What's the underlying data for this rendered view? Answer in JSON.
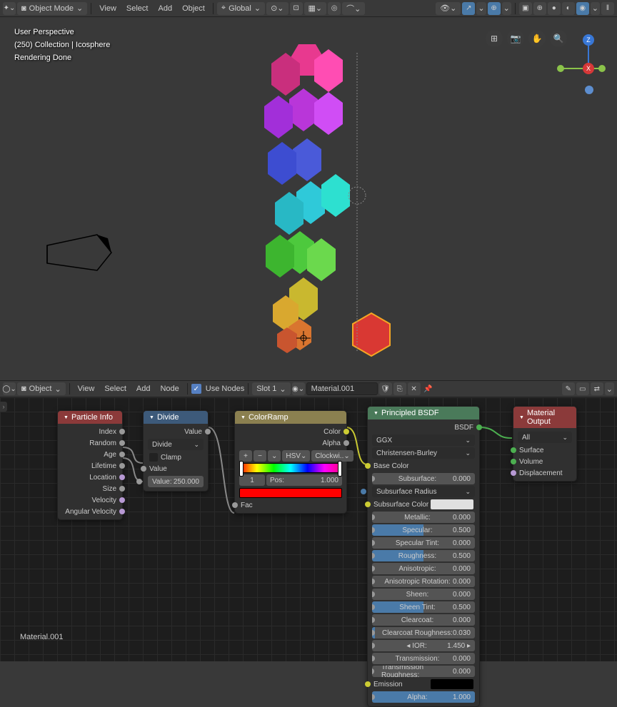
{
  "header": {
    "mode": "Object Mode",
    "menus": [
      "View",
      "Select",
      "Add",
      "Object"
    ],
    "orientation": "Global"
  },
  "viewport": {
    "perspective": "User Perspective",
    "collection": "(250) Collection | Icosphere",
    "status": "Rendering Done"
  },
  "shader_header": {
    "type": "Object",
    "menus": [
      "View",
      "Select",
      "Add",
      "Node"
    ],
    "use_nodes_label": "Use Nodes",
    "slot": "Slot 1",
    "material": "Material.001"
  },
  "nodes": {
    "particle_info": {
      "title": "Particle Info",
      "outputs": [
        "Index",
        "Random",
        "Age",
        "Lifetime",
        "Location",
        "Size",
        "Velocity",
        "Angular Velocity"
      ]
    },
    "divide": {
      "title": "Divide",
      "output": "Value",
      "operation": "Divide",
      "clamp": "Clamp",
      "value_label": "Value",
      "value": "250.000",
      "value_field": "Value:"
    },
    "colorramp": {
      "title": "ColorRamp",
      "color_out": "Color",
      "alpha_out": "Alpha",
      "interp": "HSV",
      "dir": "Clockwi..",
      "pos_field": "Pos:",
      "pos_val": "1.000",
      "idx": "1",
      "fac": "Fac"
    },
    "principled": {
      "title": "Principled BSDF",
      "output": "BSDF",
      "distribution": "GGX",
      "sss_method": "Christensen-Burley",
      "params": [
        {
          "label": "Base Color",
          "type": "socket"
        },
        {
          "label": "Subsurface:",
          "value": "0.000",
          "fill": 0
        },
        {
          "label": "Subsurface Radius",
          "type": "dropdown"
        },
        {
          "label": "Subsurface Color",
          "type": "color",
          "color": "#e0e0e0"
        },
        {
          "label": "Metallic:",
          "value": "0.000",
          "fill": 0
        },
        {
          "label": "Specular:",
          "value": "0.500",
          "fill": 50
        },
        {
          "label": "Specular Tint:",
          "value": "0.000",
          "fill": 0
        },
        {
          "label": "Roughness:",
          "value": "0.500",
          "fill": 50
        },
        {
          "label": "Anisotropic:",
          "value": "0.000",
          "fill": 0
        },
        {
          "label": "Anisotropic Rotation:",
          "value": "0.000",
          "fill": 0
        },
        {
          "label": "Sheen:",
          "value": "0.000",
          "fill": 0
        },
        {
          "label": "Sheen Tint:",
          "value": "0.500",
          "fill": 50
        },
        {
          "label": "Clearcoat:",
          "value": "0.000",
          "fill": 0
        },
        {
          "label": "Clearcoat Roughness:",
          "value": "0.030",
          "fill": 3
        },
        {
          "label": "IOR:",
          "value": "1.450",
          "type": "ior"
        },
        {
          "label": "Transmission:",
          "value": "0.000",
          "fill": 0
        },
        {
          "label": "Transmission Roughness:",
          "value": "0.000",
          "fill": 0
        },
        {
          "label": "Emission",
          "type": "color",
          "color": "#000000"
        },
        {
          "label": "Alpha:",
          "value": "1.000",
          "fill": 100
        }
      ]
    },
    "output": {
      "title": "Material Output",
      "target": "All",
      "inputs": [
        "Surface",
        "Volume",
        "Displacement"
      ]
    }
  },
  "material_label": "Material.001"
}
